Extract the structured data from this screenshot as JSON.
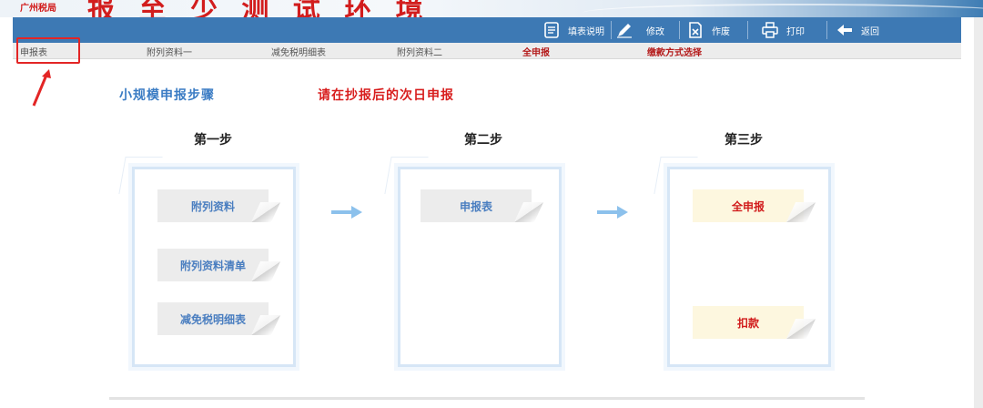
{
  "banner": {
    "small_text": "广州税局",
    "title": "报 至 少 测 试 环 境"
  },
  "toolbar": {
    "buttons": [
      {
        "label": "填表说明",
        "icon": "document-icon"
      },
      {
        "label": "修改",
        "icon": "pencil-icon"
      },
      {
        "label": "作废",
        "icon": "void-document-icon"
      },
      {
        "label": "打印",
        "icon": "printer-icon"
      },
      {
        "label": "返回",
        "icon": "back-arrow-icon"
      }
    ]
  },
  "tabs": [
    {
      "label": "申报表"
    },
    {
      "label": "附列资料一"
    },
    {
      "label": "减免税明细表"
    },
    {
      "label": "附列资料二"
    },
    {
      "label": "全申报"
    },
    {
      "label": "缴款方式选择"
    }
  ],
  "heading": {
    "title": "小规模申报步骤",
    "notice": "请在抄报后的次日申报"
  },
  "steps": [
    {
      "label": "第一步",
      "cards": [
        "附列资料",
        "附列资料清单",
        "减免税明细表"
      ]
    },
    {
      "label": "第二步",
      "cards": [
        "申报表"
      ]
    },
    {
      "label": "第三步",
      "cards": [
        "全申报",
        "扣款"
      ]
    }
  ],
  "colors": {
    "toolbar": "#3d79b4",
    "accent_blue": "#3b7cc4",
    "alert_red": "#d81e1e",
    "highlight_red": "#e32525"
  }
}
